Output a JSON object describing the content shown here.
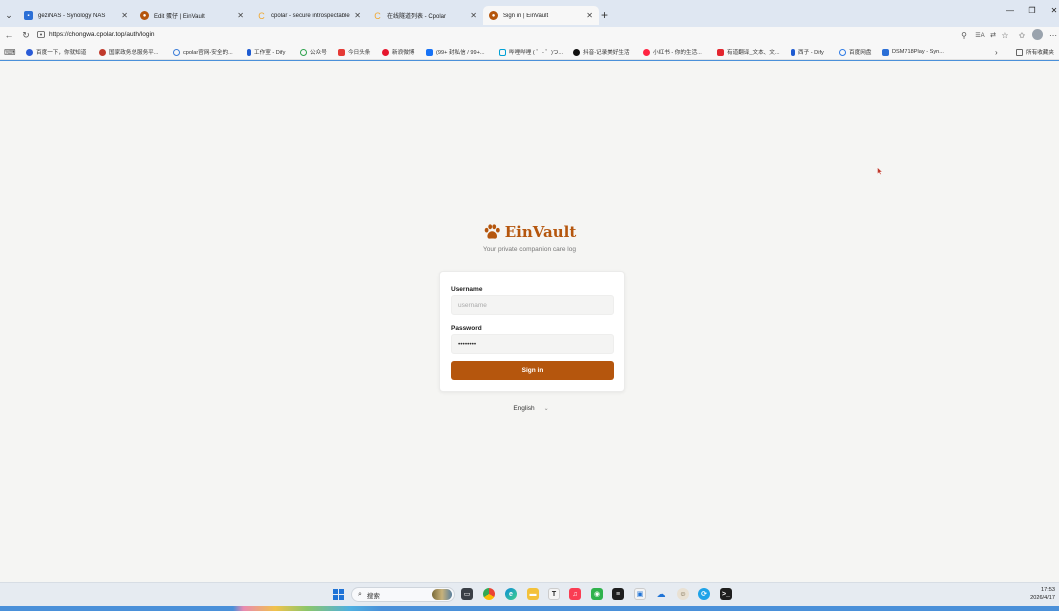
{
  "browser": {
    "tabs": [
      {
        "title": "geziNAS - Synology NAS",
        "favicon_color": "#2b6fd6",
        "active": false
      },
      {
        "title": "Edit 蛋仔 | EinVault",
        "favicon_color": "#b5560d",
        "active": false
      },
      {
        "title": "cpolar - secure introspectable tunnels to localhost",
        "favicon_color": "#f0a830",
        "active": false
      },
      {
        "title": "在线隧道列表 - Cpolar",
        "favicon_color": "#f0a830",
        "active": false
      },
      {
        "title": "Sign in | EinVault",
        "favicon_color": "#b5560d",
        "active": true
      }
    ],
    "new_tab": "+",
    "window_controls": {
      "minimize": "—",
      "restore": "❐",
      "close": "✕"
    },
    "url": "https://chongwa.cpolar.top/auth/login",
    "bookmarks": [
      {
        "label": "百度一下，你就知道",
        "color": "#2a5bd7"
      },
      {
        "label": "国家政务总服务平...",
        "color": "#c0392b"
      },
      {
        "label": "cpolar官网-安全的...",
        "color": "#3b7dd8"
      },
      {
        "label": "工作室 - Dify",
        "color": "#1e5bd1"
      },
      {
        "label": "公众号",
        "color": "#2ea34d"
      },
      {
        "label": "今日头条",
        "color": "#e53935"
      },
      {
        "label": "新浪微博",
        "color": "#e6162d"
      },
      {
        "label": "(99+ 封私信 / 99+...",
        "color": "#1772f6"
      },
      {
        "label": "哔哩哔哩 ( ゜- ゜)つ...",
        "color": "#00a1d6"
      },
      {
        "label": "抖音-记录美好生活",
        "color": "#111111"
      },
      {
        "label": "小红书 - 你的生活...",
        "color": "#ff2442"
      },
      {
        "label": "有道翻译_文本、文...",
        "color": "#e3262f"
      },
      {
        "label": "西子 - Dify",
        "color": "#1e5bd1"
      },
      {
        "label": "百度网盘",
        "color": "#2e7be6"
      },
      {
        "label": "DSM718Play - Syn...",
        "color": "#2b6fd6"
      }
    ],
    "bookmarks_more": "›",
    "all_favorites_label": "所有收藏夹"
  },
  "page": {
    "brand_name": "EinVault",
    "tagline": "Your private companion care log",
    "username_label": "Username",
    "username_placeholder": "username",
    "password_label": "Password",
    "password_value": "••••••••",
    "sign_in_button": "Sign in",
    "language": "English",
    "accent_color": "#b5560d"
  },
  "taskbar": {
    "search_placeholder": "搜索",
    "time": "17:53",
    "date": "2026/4/17"
  }
}
